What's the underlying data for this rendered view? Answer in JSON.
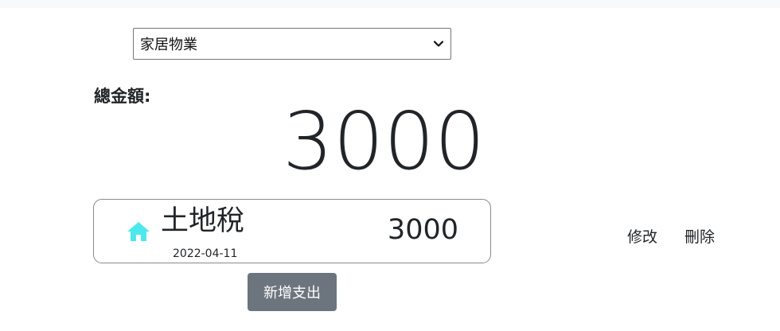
{
  "category_select": {
    "selected": "家居物業",
    "icon": "chevron-down-icon"
  },
  "summary": {
    "total_label": "總金額:",
    "total_amount": "3000"
  },
  "expenses": [
    {
      "icon": "home-icon",
      "icon_color": "#4de8ec",
      "name": "土地稅",
      "date": "2022-04-11",
      "amount": "3000"
    }
  ],
  "actions": {
    "edit_label": "修改",
    "delete_label": "刪除",
    "add_label": "新增支出"
  },
  "colors": {
    "add_button_bg": "#6c757d",
    "topbar_bg": "#f8f9fa"
  }
}
